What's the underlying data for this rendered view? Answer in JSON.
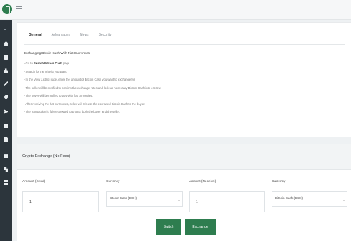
{
  "app": {
    "menu_icon": "hamburger-icon",
    "logo_icon": "logo-icon"
  },
  "sidebar": {
    "icons": [
      "dashboard-icon",
      "home-icon",
      "wallet-icon",
      "users-icon",
      "key-icon",
      "tag-icon",
      "send-icon",
      "card-icon",
      "document-icon",
      "gift-icon",
      "language-icon",
      "list-icon"
    ]
  },
  "tabs": [
    "General",
    "Advantages",
    "News",
    "Security"
  ],
  "tabs_active": "General",
  "info": {
    "heading": "Exchanging Bitcoin Cash With Fiat Currencies",
    "step1_prefix": "- Go to ",
    "step1_link": "Search Bitcoin Cash",
    "step1_suffix": " page.",
    "steps": [
      "- Search for the criteria you want.",
      "- In the View Listing page, enter the amount of Bitcoin Cash you want to exchange for.",
      "- The seller will be notified to confirm the exchange rates and lock up necessary Bitcoin Cash into escrow.",
      "- The buyer will be notified to pay with fiat currencies.",
      "- After receiving the fiat currencies, seller will release the escrowed Bitcoin Cash to the buyer.",
      "- The transaction is fully escrowed to protect both the buyer and the seller."
    ]
  },
  "exchange": {
    "title": "Crypto Exchange (No Fees)",
    "send_label": "Amount (Send)",
    "send_value": "1",
    "currency1_label": "Currency",
    "currency1_value": "Bitcoin Cash (BCH)",
    "receive_label": "Amount (Receive)",
    "receive_value": "1",
    "currency2_label": "Currency",
    "currency2_value": "Bitcoin Cash (BCH)",
    "switch_label": "Switch",
    "exchange_label": "Exchange"
  },
  "colors": {
    "accent": "#2e7d4f",
    "sidebar": "#2c353c",
    "background": "#eef1f3"
  }
}
